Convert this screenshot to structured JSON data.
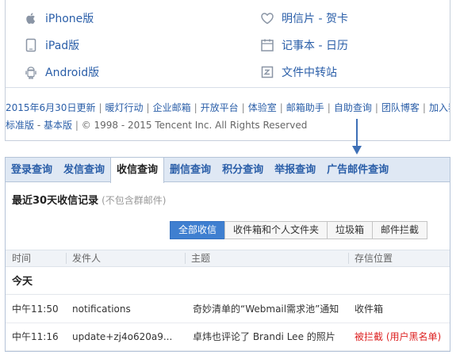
{
  "top_links": {
    "left": [
      {
        "label": "iPhone版",
        "icon": "apple-icon"
      },
      {
        "label": "iPad版",
        "icon": "tablet-icon"
      },
      {
        "label": "Android版",
        "icon": "android-icon"
      }
    ],
    "right": [
      {
        "label": "明信片 - 贺卡",
        "icon": "heart-icon"
      },
      {
        "label": "记事本 - 日历",
        "icon": "calendar-icon"
      },
      {
        "label": "文件中转站",
        "icon": "file-transfer-icon"
      }
    ]
  },
  "footer": {
    "links": [
      "2015年6月30日更新",
      "暖灯行动",
      "企业邮箱",
      "开放平台",
      "体验室",
      "邮箱助手",
      "自助查询",
      "团队博客",
      "加入我们"
    ],
    "version_standard": "标准版",
    "version_basic": "基本版",
    "copyright": "© 1998 - 2015 Tencent Inc. All Rights Reserved"
  },
  "tabs": [
    "登录查询",
    "发信查询",
    "收信查询",
    "删信查询",
    "积分查询",
    "举报查询",
    "广告邮件查询"
  ],
  "active_tab_index": 2,
  "section": {
    "title": "最近30天收信记录",
    "note": "(不包含群邮件)"
  },
  "filters": [
    "全部收信",
    "收件箱和个人文件夹",
    "垃圾箱",
    "邮件拦截"
  ],
  "active_filter_index": 0,
  "table": {
    "columns": [
      "时间",
      "发件人",
      "主题",
      "存信位置"
    ],
    "group_label": "今天",
    "rows": [
      {
        "time": "中午11:50",
        "sender": "notifications",
        "subject": "奇妙清单的“Webmail需求池”通知",
        "location": "收件箱",
        "location_color": "#333333"
      },
      {
        "time": "中午11:16",
        "sender": "update+zj4o620a9...",
        "subject": "卓炜也评论了 Brandi Lee 的照片",
        "location": "被拦截 (用户黑名单)",
        "location_color": "#dd2222"
      }
    ]
  },
  "colors": {
    "link": "#2a5ea8",
    "tab_bg": "#dfe8f4",
    "active_filter": "#3f7fd0",
    "arrow": "#3d6fb6"
  }
}
